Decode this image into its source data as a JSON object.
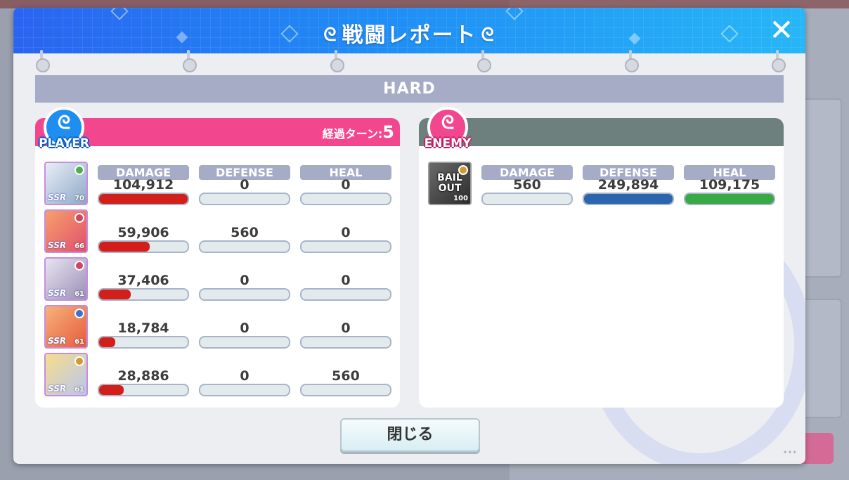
{
  "dialog": {
    "title": "戦闘レポート",
    "title_icon": "wing-icon",
    "close_icon": "close-icon",
    "close_glyph": "✕"
  },
  "difficulty": "HARD",
  "player": {
    "badge_label": "PLAYER",
    "turns_label": "経過ターン:",
    "turns_value": "5",
    "headers": {
      "damage": "DAMAGE",
      "defense": "DEFENSE",
      "heal": "HEAL"
    },
    "members": [
      {
        "damage": "104,912",
        "defense": "0",
        "heal": "0",
        "level": "70",
        "damage_fill": 1.0,
        "defense_fill": 0,
        "heal_fill": 0,
        "attr_color": "#4cb04c",
        "art": [
          "#e8eef6",
          "#8fa8c8"
        ]
      },
      {
        "damage": "59,906",
        "defense": "560",
        "heal": "0",
        "level": "66",
        "damage_fill": 0.57,
        "defense_fill": 0,
        "heal_fill": 0,
        "attr_color": "#d0455e",
        "art": [
          "#f7a06a",
          "#e0506d"
        ]
      },
      {
        "damage": "37,406",
        "defense": "0",
        "heal": "0",
        "level": "61",
        "damage_fill": 0.36,
        "defense_fill": 0,
        "heal_fill": 0,
        "attr_color": "#d0455e",
        "art": [
          "#e8e4ef",
          "#9a8fb8"
        ]
      },
      {
        "damage": "18,784",
        "defense": "0",
        "heal": "0",
        "level": "61",
        "damage_fill": 0.18,
        "defense_fill": 0,
        "heal_fill": 0,
        "attr_color": "#3d72c9",
        "art": [
          "#f6b27a",
          "#e75b3c"
        ]
      },
      {
        "damage": "28,886",
        "defense": "0",
        "heal": "560",
        "level": "61",
        "damage_fill": 0.28,
        "defense_fill": 0,
        "heal_fill": 0,
        "attr_color": "#d09a33",
        "art": [
          "#f8dd8b",
          "#b9c6ee"
        ]
      }
    ],
    "rank_label": "SSR"
  },
  "enemy": {
    "badge_label": "ENEMY",
    "headers": {
      "damage": "DAMAGE",
      "defense": "DEFENSE",
      "heal": "HEAL"
    },
    "members": [
      {
        "damage": "560",
        "defense": "249,894",
        "heal": "109,175",
        "level": "100",
        "damage_fill": 0,
        "defense_fill": 1.0,
        "heal_fill": 1.0,
        "attr_color": "#d09a33",
        "avatar_text_1": "BAIL",
        "avatar_text_2": "OUT"
      }
    ]
  },
  "footer": {
    "close_label": "閉じる"
  },
  "colors": {
    "player": "#f2468f",
    "enemy": "#6d807e",
    "damage": "#d21f1a",
    "defense": "#2a65ad",
    "heal": "#37a945",
    "header_bar": "#a6abc6"
  }
}
